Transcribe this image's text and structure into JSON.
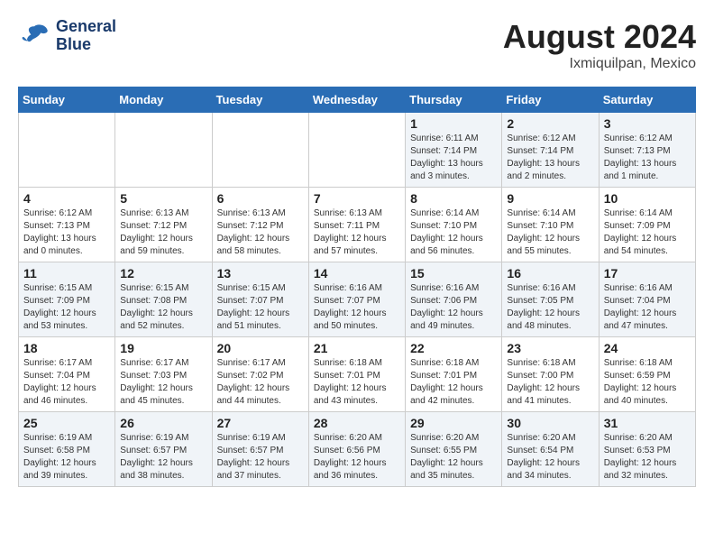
{
  "header": {
    "logo_line1": "General",
    "logo_line2": "Blue",
    "month_year": "August 2024",
    "location": "Ixmiquilpan, Mexico"
  },
  "days_of_week": [
    "Sunday",
    "Monday",
    "Tuesday",
    "Wednesday",
    "Thursday",
    "Friday",
    "Saturday"
  ],
  "weeks": [
    [
      {
        "day": "",
        "info": ""
      },
      {
        "day": "",
        "info": ""
      },
      {
        "day": "",
        "info": ""
      },
      {
        "day": "",
        "info": ""
      },
      {
        "day": "1",
        "info": "Sunrise: 6:11 AM\nSunset: 7:14 PM\nDaylight: 13 hours\nand 3 minutes."
      },
      {
        "day": "2",
        "info": "Sunrise: 6:12 AM\nSunset: 7:14 PM\nDaylight: 13 hours\nand 2 minutes."
      },
      {
        "day": "3",
        "info": "Sunrise: 6:12 AM\nSunset: 7:13 PM\nDaylight: 13 hours\nand 1 minute."
      }
    ],
    [
      {
        "day": "4",
        "info": "Sunrise: 6:12 AM\nSunset: 7:13 PM\nDaylight: 13 hours\nand 0 minutes."
      },
      {
        "day": "5",
        "info": "Sunrise: 6:13 AM\nSunset: 7:12 PM\nDaylight: 12 hours\nand 59 minutes."
      },
      {
        "day": "6",
        "info": "Sunrise: 6:13 AM\nSunset: 7:12 PM\nDaylight: 12 hours\nand 58 minutes."
      },
      {
        "day": "7",
        "info": "Sunrise: 6:13 AM\nSunset: 7:11 PM\nDaylight: 12 hours\nand 57 minutes."
      },
      {
        "day": "8",
        "info": "Sunrise: 6:14 AM\nSunset: 7:10 PM\nDaylight: 12 hours\nand 56 minutes."
      },
      {
        "day": "9",
        "info": "Sunrise: 6:14 AM\nSunset: 7:10 PM\nDaylight: 12 hours\nand 55 minutes."
      },
      {
        "day": "10",
        "info": "Sunrise: 6:14 AM\nSunset: 7:09 PM\nDaylight: 12 hours\nand 54 minutes."
      }
    ],
    [
      {
        "day": "11",
        "info": "Sunrise: 6:15 AM\nSunset: 7:09 PM\nDaylight: 12 hours\nand 53 minutes."
      },
      {
        "day": "12",
        "info": "Sunrise: 6:15 AM\nSunset: 7:08 PM\nDaylight: 12 hours\nand 52 minutes."
      },
      {
        "day": "13",
        "info": "Sunrise: 6:15 AM\nSunset: 7:07 PM\nDaylight: 12 hours\nand 51 minutes."
      },
      {
        "day": "14",
        "info": "Sunrise: 6:16 AM\nSunset: 7:07 PM\nDaylight: 12 hours\nand 50 minutes."
      },
      {
        "day": "15",
        "info": "Sunrise: 6:16 AM\nSunset: 7:06 PM\nDaylight: 12 hours\nand 49 minutes."
      },
      {
        "day": "16",
        "info": "Sunrise: 6:16 AM\nSunset: 7:05 PM\nDaylight: 12 hours\nand 48 minutes."
      },
      {
        "day": "17",
        "info": "Sunrise: 6:16 AM\nSunset: 7:04 PM\nDaylight: 12 hours\nand 47 minutes."
      }
    ],
    [
      {
        "day": "18",
        "info": "Sunrise: 6:17 AM\nSunset: 7:04 PM\nDaylight: 12 hours\nand 46 minutes."
      },
      {
        "day": "19",
        "info": "Sunrise: 6:17 AM\nSunset: 7:03 PM\nDaylight: 12 hours\nand 45 minutes."
      },
      {
        "day": "20",
        "info": "Sunrise: 6:17 AM\nSunset: 7:02 PM\nDaylight: 12 hours\nand 44 minutes."
      },
      {
        "day": "21",
        "info": "Sunrise: 6:18 AM\nSunset: 7:01 PM\nDaylight: 12 hours\nand 43 minutes."
      },
      {
        "day": "22",
        "info": "Sunrise: 6:18 AM\nSunset: 7:01 PM\nDaylight: 12 hours\nand 42 minutes."
      },
      {
        "day": "23",
        "info": "Sunrise: 6:18 AM\nSunset: 7:00 PM\nDaylight: 12 hours\nand 41 minutes."
      },
      {
        "day": "24",
        "info": "Sunrise: 6:18 AM\nSunset: 6:59 PM\nDaylight: 12 hours\nand 40 minutes."
      }
    ],
    [
      {
        "day": "25",
        "info": "Sunrise: 6:19 AM\nSunset: 6:58 PM\nDaylight: 12 hours\nand 39 minutes."
      },
      {
        "day": "26",
        "info": "Sunrise: 6:19 AM\nSunset: 6:57 PM\nDaylight: 12 hours\nand 38 minutes."
      },
      {
        "day": "27",
        "info": "Sunrise: 6:19 AM\nSunset: 6:57 PM\nDaylight: 12 hours\nand 37 minutes."
      },
      {
        "day": "28",
        "info": "Sunrise: 6:20 AM\nSunset: 6:56 PM\nDaylight: 12 hours\nand 36 minutes."
      },
      {
        "day": "29",
        "info": "Sunrise: 6:20 AM\nSunset: 6:55 PM\nDaylight: 12 hours\nand 35 minutes."
      },
      {
        "day": "30",
        "info": "Sunrise: 6:20 AM\nSunset: 6:54 PM\nDaylight: 12 hours\nand 34 minutes."
      },
      {
        "day": "31",
        "info": "Sunrise: 6:20 AM\nSunset: 6:53 PM\nDaylight: 12 hours\nand 32 minutes."
      }
    ]
  ]
}
